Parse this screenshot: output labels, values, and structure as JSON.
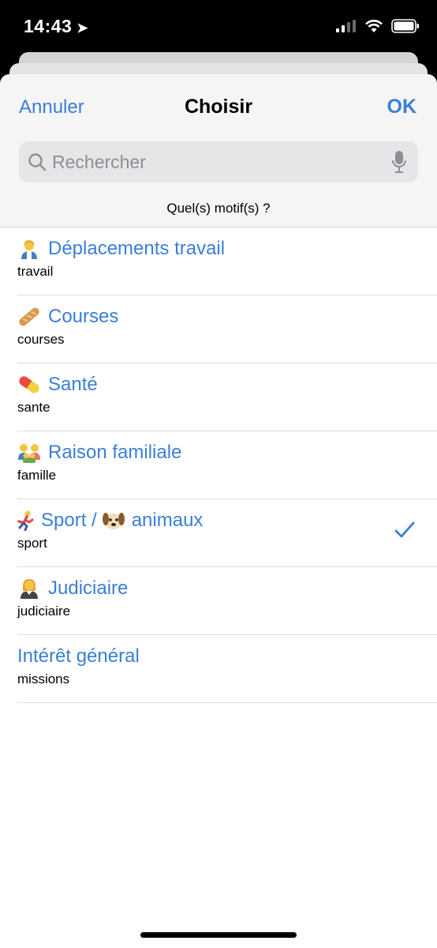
{
  "status_bar": {
    "time": "14:43"
  },
  "nav": {
    "cancel_label": "Annuler",
    "title": "Choisir",
    "ok_label": "OK"
  },
  "search": {
    "placeholder": "Rechercher",
    "value": ""
  },
  "subtitle": "Quel(s) motif(s) ?",
  "items": [
    {
      "title": "Déplacements travail",
      "subtitle": "travail",
      "icon": "office-worker-emoji",
      "checked": false
    },
    {
      "title": "Courses",
      "subtitle": "courses",
      "icon": "baguette-emoji",
      "checked": false
    },
    {
      "title": "Santé",
      "subtitle": "sante",
      "icon": "pill-emoji",
      "checked": false
    },
    {
      "title": "Raison familiale",
      "subtitle": "famille",
      "icon": "family-emoji",
      "checked": false
    },
    {
      "title": "Sport / ",
      "title_suffix": "animaux",
      "subtitle": "sport",
      "icon": "runner-emoji",
      "icon2": "dog-emoji",
      "checked": true
    },
    {
      "title": "Judiciaire",
      "subtitle": "judiciaire",
      "icon": "judge-emoji",
      "checked": false
    },
    {
      "title": "Intérêt général",
      "subtitle": "missions",
      "checked": false
    }
  ],
  "colors": {
    "accent": "#3a7fd5",
    "header_bg": "#f5f5f6",
    "search_bg": "#e6e6e9"
  }
}
